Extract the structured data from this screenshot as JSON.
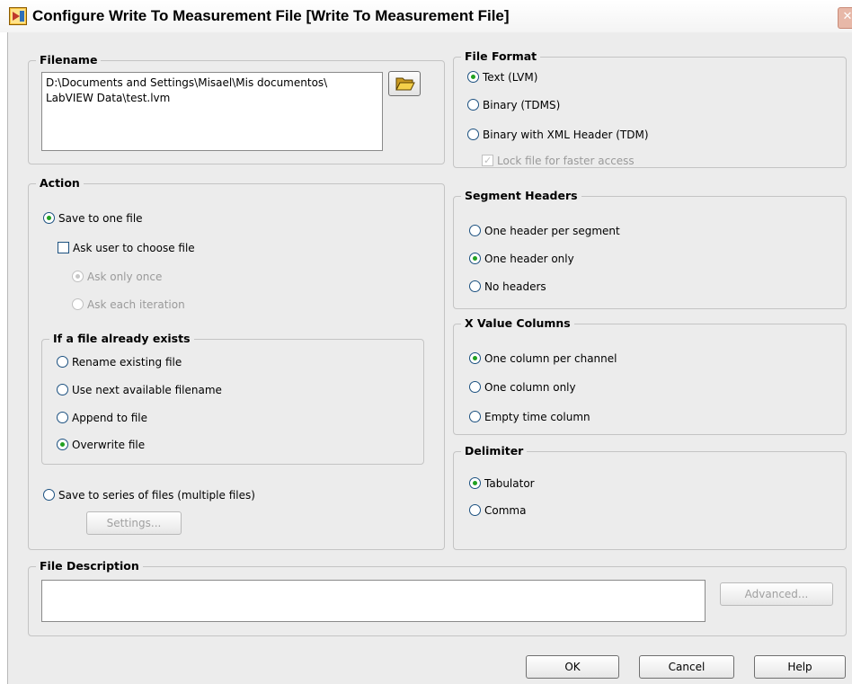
{
  "window": {
    "title": "Configure Write To Measurement File [Write To Measurement File]",
    "close_glyph": "✕",
    "icon": "labview-vi-icon"
  },
  "filename": {
    "legend": "Filename",
    "value": "D:\\Documents and Settings\\Misael\\Mis documentos\\\nLabVIEW Data\\test.lvm",
    "browse_icon": "folder-open-icon"
  },
  "action": {
    "legend": "Action",
    "save_one": "Save to one file",
    "ask_user": "Ask user to choose file",
    "ask_once": "Ask only once",
    "ask_each": "Ask each iteration",
    "exists_legend": "If a file already exists",
    "exists_options": [
      "Rename existing file",
      "Use next available filename",
      "Append to file",
      "Overwrite file"
    ],
    "save_series": "Save to series of files (multiple files)",
    "settings_button": "Settings..."
  },
  "file_format": {
    "legend": "File Format",
    "options": [
      "Text (LVM)",
      "Binary (TDMS)",
      "Binary with XML Header (TDM)"
    ],
    "lock_label": "Lock file for faster access"
  },
  "segment_headers": {
    "legend": "Segment Headers",
    "options": [
      "One header per segment",
      "One header only",
      "No headers"
    ]
  },
  "x_value_columns": {
    "legend": "X Value Columns",
    "options": [
      "One column per channel",
      "One column only",
      "Empty time column"
    ]
  },
  "delimiter": {
    "legend": "Delimiter",
    "options": [
      "Tabulator",
      "Comma"
    ]
  },
  "file_description": {
    "legend": "File Description",
    "value": "",
    "advanced_button": "Advanced..."
  },
  "footer": {
    "ok": "OK",
    "cancel": "Cancel",
    "help": "Help"
  },
  "colors": {
    "dialog_bg": "#ececec",
    "radio_selected": "#21a121",
    "radio_border": "#1c5180"
  }
}
